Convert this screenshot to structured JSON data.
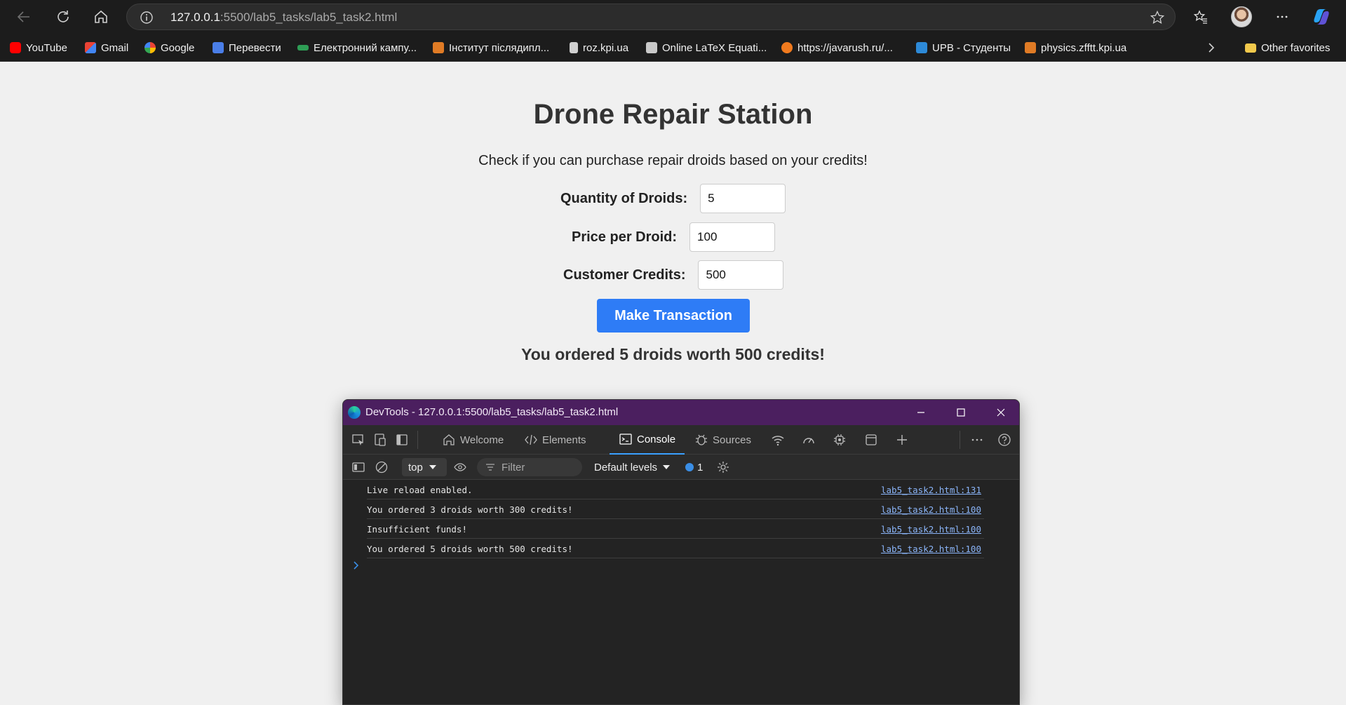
{
  "browser": {
    "url_host": "127.0.0.1",
    "url_path": ":5500/lab5_tasks/lab5_task2.html",
    "bookmarks": [
      {
        "label": "YouTube",
        "icon": "youtube-icon",
        "color": "#ff0000"
      },
      {
        "label": "Gmail",
        "icon": "gmail-icon",
        "color": "#ea4335"
      },
      {
        "label": "Google",
        "icon": "google-icon",
        "color": "#4285f4"
      },
      {
        "label": "Перевести",
        "icon": "translate-icon",
        "color": "#4a7ee8"
      },
      {
        "label": "Електронний кампу...",
        "icon": "campus-icon",
        "color": "#2e9d55"
      },
      {
        "label": "Інститут післядипл...",
        "icon": "institute-icon",
        "color": "#e07b25"
      },
      {
        "label": "roz.kpi.ua",
        "icon": "page-icon",
        "color": "#d0d0d0"
      },
      {
        "label": "Online LaTeX Equati...",
        "icon": "latex-icon",
        "color": "#c9c9c9"
      },
      {
        "label": "https://javarush.ru/...",
        "icon": "javarush-icon",
        "color": "#f07a1e"
      },
      {
        "label": "UPB - Студенты",
        "icon": "upb-icon",
        "color": "#2d8ad8"
      },
      {
        "label": "physics.zfftt.kpi.ua",
        "icon": "physics-icon",
        "color": "#e07b25"
      }
    ],
    "other_favorites": "Other favorites"
  },
  "page": {
    "title": "Drone Repair Station",
    "description": "Check if you can purchase repair droids based on your credits!",
    "fields": {
      "quantity": {
        "label": "Quantity of Droids:",
        "value": "5"
      },
      "price": {
        "label": "Price per Droid:",
        "value": "100"
      },
      "credits": {
        "label": "Customer Credits:",
        "value": "500"
      }
    },
    "button_label": "Make Transaction",
    "result": "You ordered 5 droids worth 500 credits!",
    "accent_color": "#2e7cf6"
  },
  "devtools": {
    "window_title": "DevTools - 127.0.0.1:5500/lab5_tasks/lab5_task2.html",
    "tabs": {
      "welcome": "Welcome",
      "elements": "Elements",
      "console": "Console",
      "sources": "Sources"
    },
    "context": "top",
    "filter_placeholder": "Filter",
    "levels": "Default levels",
    "issues_count": "1",
    "logs": [
      {
        "message": "Live reload enabled.",
        "source": "lab5_task2.html:131"
      },
      {
        "message": "You ordered 3 droids worth 300 credits!",
        "source": "lab5_task2.html:100"
      },
      {
        "message": "Insufficient funds!",
        "source": "lab5_task2.html:100"
      },
      {
        "message": "You ordered 5 droids worth 500 credits!",
        "source": "lab5_task2.html:100"
      }
    ]
  }
}
